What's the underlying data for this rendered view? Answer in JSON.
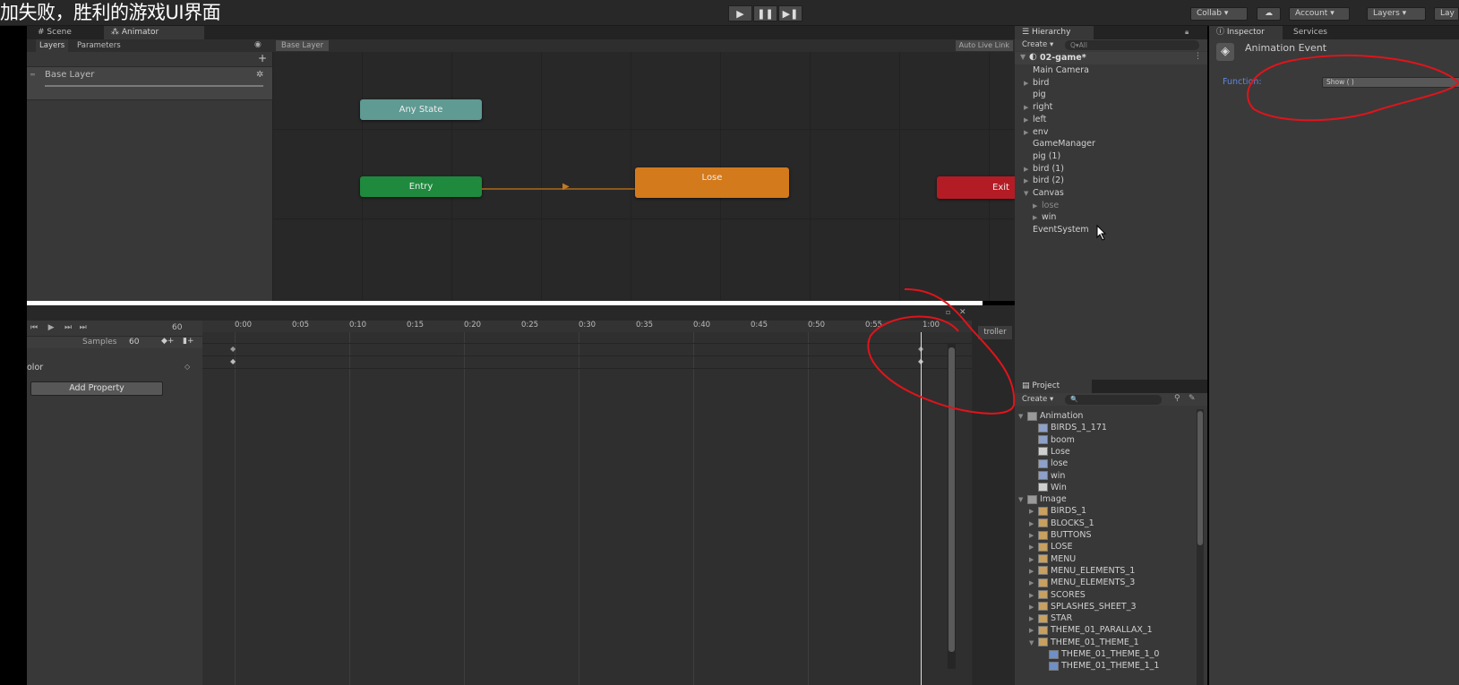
{
  "caption": "加失败，胜利的游戏UI界面",
  "toolbar": {
    "collab": "Collab ▾",
    "account": "Account",
    "layers": "Layers",
    "layout": "Lay"
  },
  "scene_tabs": {
    "scene": "Scene",
    "animator": "Animator"
  },
  "animator": {
    "layers_tab": "Layers",
    "parameters_tab": "Parameters",
    "layer_name": "Base Layer",
    "breadcrumb": "Base Layer",
    "auto_live_link": "Auto Live Link",
    "add_button": "+",
    "nodes": {
      "any_state": "Any State",
      "entry": "Entry",
      "lose": "Lose",
      "exit": "Exit"
    }
  },
  "animation": {
    "frame": "60",
    "samples_label": "Samples",
    "samples_value": "60",
    "property_label": "olor",
    "add_property": "Add Property",
    "controller_tab": "troller",
    "timeline": [
      "0:00",
      "0:05",
      "0:10",
      "0:15",
      "0:20",
      "0:25",
      "0:30",
      "0:35",
      "0:40",
      "0:45",
      "0:50",
      "0:55",
      "1:00"
    ]
  },
  "hierarchy": {
    "tab": "Hierarchy",
    "create": "Create ▾",
    "search_placeholder": "Q▾All",
    "scene_name": "02-game*",
    "items": [
      {
        "label": "Main Camera",
        "arrow": "",
        "indent": 1
      },
      {
        "label": "bird",
        "arrow": "▶",
        "indent": 1
      },
      {
        "label": "pig",
        "arrow": "",
        "indent": 1
      },
      {
        "label": "right",
        "arrow": "▶",
        "indent": 1
      },
      {
        "label": "left",
        "arrow": "▶",
        "indent": 1
      },
      {
        "label": "env",
        "arrow": "▶",
        "indent": 1
      },
      {
        "label": "GameManager",
        "arrow": "",
        "indent": 1
      },
      {
        "label": "pig (1)",
        "arrow": "",
        "indent": 1
      },
      {
        "label": "bird (1)",
        "arrow": "▶",
        "indent": 1
      },
      {
        "label": "bird (2)",
        "arrow": "▶",
        "indent": 1
      },
      {
        "label": "Canvas",
        "arrow": "▼",
        "indent": 1
      },
      {
        "label": "lose",
        "arrow": "▶",
        "indent": 2,
        "dim": true
      },
      {
        "label": "win",
        "arrow": "▶",
        "indent": 2
      },
      {
        "label": "EventSystem",
        "arrow": "",
        "indent": 1
      }
    ]
  },
  "inspector": {
    "tab": "Inspector",
    "services_tab": "Services",
    "title": "Animation Event",
    "function_label": "Function:",
    "function_value": "Show ( )"
  },
  "project": {
    "tab": "Project",
    "create": "Create ▾",
    "search_placeholder": "🔍",
    "items": [
      {
        "label": "Animation",
        "level": 0,
        "arrow": "▼",
        "type": "folder"
      },
      {
        "label": "BIRDS_1_171",
        "level": 1,
        "arrow": "",
        "type": "anim"
      },
      {
        "label": "boom",
        "level": 1,
        "arrow": "",
        "type": "anim"
      },
      {
        "label": "Lose",
        "level": 1,
        "arrow": "",
        "type": "clip"
      },
      {
        "label": "lose",
        "level": 1,
        "arrow": "",
        "type": "anim"
      },
      {
        "label": "win",
        "level": 1,
        "arrow": "",
        "type": "anim"
      },
      {
        "label": "Win",
        "level": 1,
        "arrow": "",
        "type": "clip"
      },
      {
        "label": "Image",
        "level": 0,
        "arrow": "▼",
        "type": "folder"
      },
      {
        "label": "BIRDS_1",
        "level": 1,
        "arrow": "▶",
        "type": "sprite"
      },
      {
        "label": "BLOCKS_1",
        "level": 1,
        "arrow": "▶",
        "type": "sprite"
      },
      {
        "label": "BUTTONS",
        "level": 1,
        "arrow": "▶",
        "type": "sprite"
      },
      {
        "label": "LOSE",
        "level": 1,
        "arrow": "▶",
        "type": "sprite"
      },
      {
        "label": "MENU",
        "level": 1,
        "arrow": "▶",
        "type": "sprite"
      },
      {
        "label": "MENU_ELEMENTS_1",
        "level": 1,
        "arrow": "▶",
        "type": "sprite"
      },
      {
        "label": "MENU_ELEMENTS_3",
        "level": 1,
        "arrow": "▶",
        "type": "sprite"
      },
      {
        "label": "SCORES",
        "level": 1,
        "arrow": "▶",
        "type": "sprite"
      },
      {
        "label": "SPLASHES_SHEET_3",
        "level": 1,
        "arrow": "▶",
        "type": "sprite"
      },
      {
        "label": "STAR",
        "level": 1,
        "arrow": "▶",
        "type": "sprite"
      },
      {
        "label": "THEME_01_PARALLAX_1",
        "level": 1,
        "arrow": "▶",
        "type": "sprite"
      },
      {
        "label": "THEME_01_THEME_1",
        "level": 1,
        "arrow": "▼",
        "type": "sprite"
      },
      {
        "label": "THEME_01_THEME_1_0",
        "level": 2,
        "arrow": "",
        "type": "sub"
      },
      {
        "label": "THEME_01_THEME_1_1",
        "level": 2,
        "arrow": "",
        "type": "sub"
      }
    ]
  },
  "colors": {
    "any_state": "#5f9a93",
    "entry": "#1f8a3e",
    "lose": "#d37a1c",
    "exit": "#b41c25",
    "annotation": "#e0141b"
  }
}
